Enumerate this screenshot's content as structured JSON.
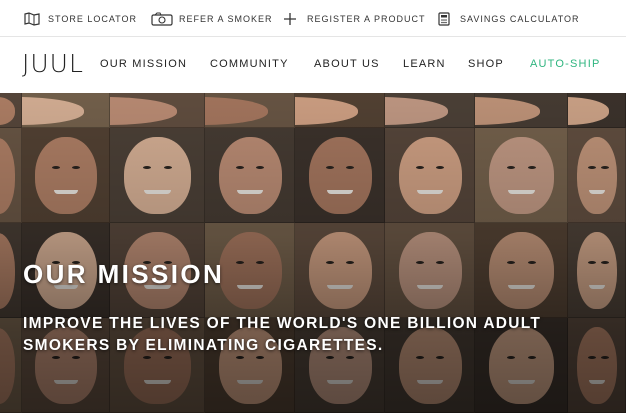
{
  "utility_bar": {
    "items": [
      {
        "label": "STORE LOCATOR",
        "icon": "map-icon"
      },
      {
        "label": "REFER A SMOKER",
        "icon": "refer-icon"
      },
      {
        "label": "REGISTER A PRODUCT",
        "icon": "plus-icon"
      },
      {
        "label": "SAVINGS CALCULATOR",
        "icon": "calculator-icon"
      }
    ]
  },
  "nav": {
    "logo": "JUUL",
    "links": [
      {
        "label": "OUR MISSION"
      },
      {
        "label": "COMMUNITY"
      },
      {
        "label": "ABOUT US"
      },
      {
        "label": "LEARN"
      },
      {
        "label": "SHOP"
      },
      {
        "label": "AUTO-SHIP"
      }
    ]
  },
  "hero": {
    "title": "OUR MISSION",
    "subtitle": "IMPROVE THE LIVES OF THE WORLD'S ONE BILLION ADULT SMOKERS BY ELIMINATING CIGARETTES."
  },
  "colors": {
    "accent": "#2fb57f",
    "text": "#222222",
    "hero_text": "#ffffff"
  }
}
